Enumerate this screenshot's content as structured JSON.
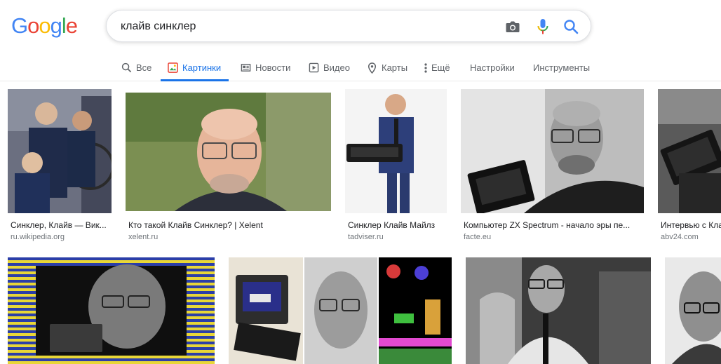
{
  "logo": {
    "letters": [
      "G",
      "o",
      "o",
      "g",
      "l",
      "e"
    ]
  },
  "search": {
    "query": "клайв синклер"
  },
  "tabs": [
    {
      "label": "Все",
      "icon": "search-icon"
    },
    {
      "label": "Картинки",
      "icon": "image-icon",
      "active": true
    },
    {
      "label": "Новости",
      "icon": "newspaper-icon"
    },
    {
      "label": "Видео",
      "icon": "play-icon"
    },
    {
      "label": "Карты",
      "icon": "map-pin-icon"
    },
    {
      "label": "Ещё",
      "icon": "more-vert-icon"
    },
    {
      "label": "Настройки"
    },
    {
      "label": "Инструменты"
    }
  ],
  "results": [
    {
      "caption": "Синклер, Клайв — Вик...",
      "domain": "ru.wikipedia.org"
    },
    {
      "caption": "Кто такой Клайв Синклер? | Xelent",
      "domain": "xelent.ru"
    },
    {
      "caption": "Синклер Клайв Майлз",
      "domain": "tadviser.ru"
    },
    {
      "caption": "Компьютер ZX Spectrum - начало эры пе...",
      "domain": "facte.eu"
    },
    {
      "caption": "Интервью с Клайвом",
      "domain": "abv24.com"
    }
  ],
  "colors": {
    "accent": "#1a73e8",
    "tab_text": "#5f6368",
    "domain_text": "#70757a",
    "border": "#dfe1e5"
  }
}
